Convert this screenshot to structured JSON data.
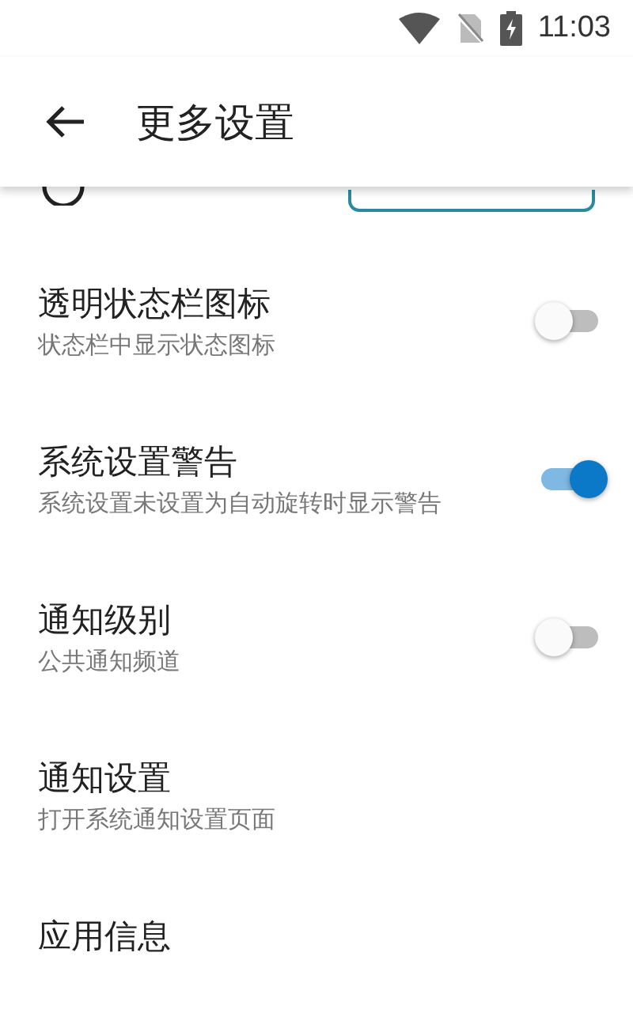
{
  "status_bar": {
    "time": "11:03"
  },
  "app_bar": {
    "title": "更多设置"
  },
  "settings": [
    {
      "kind": "partial"
    },
    {
      "kind": "switch",
      "title": "透明状态栏图标",
      "subtitle": "状态栏中显示状态图标",
      "on": false
    },
    {
      "kind": "switch",
      "title": "系统设置警告",
      "subtitle": "系统设置未设置为自动旋转时显示警告",
      "on": true
    },
    {
      "kind": "switch",
      "title": "通知级别",
      "subtitle": "公共通知频道",
      "on": false
    },
    {
      "kind": "link",
      "title": "通知设置",
      "subtitle": "打开系统通知设置页面"
    },
    {
      "kind": "link",
      "title": "应用信息"
    }
  ]
}
